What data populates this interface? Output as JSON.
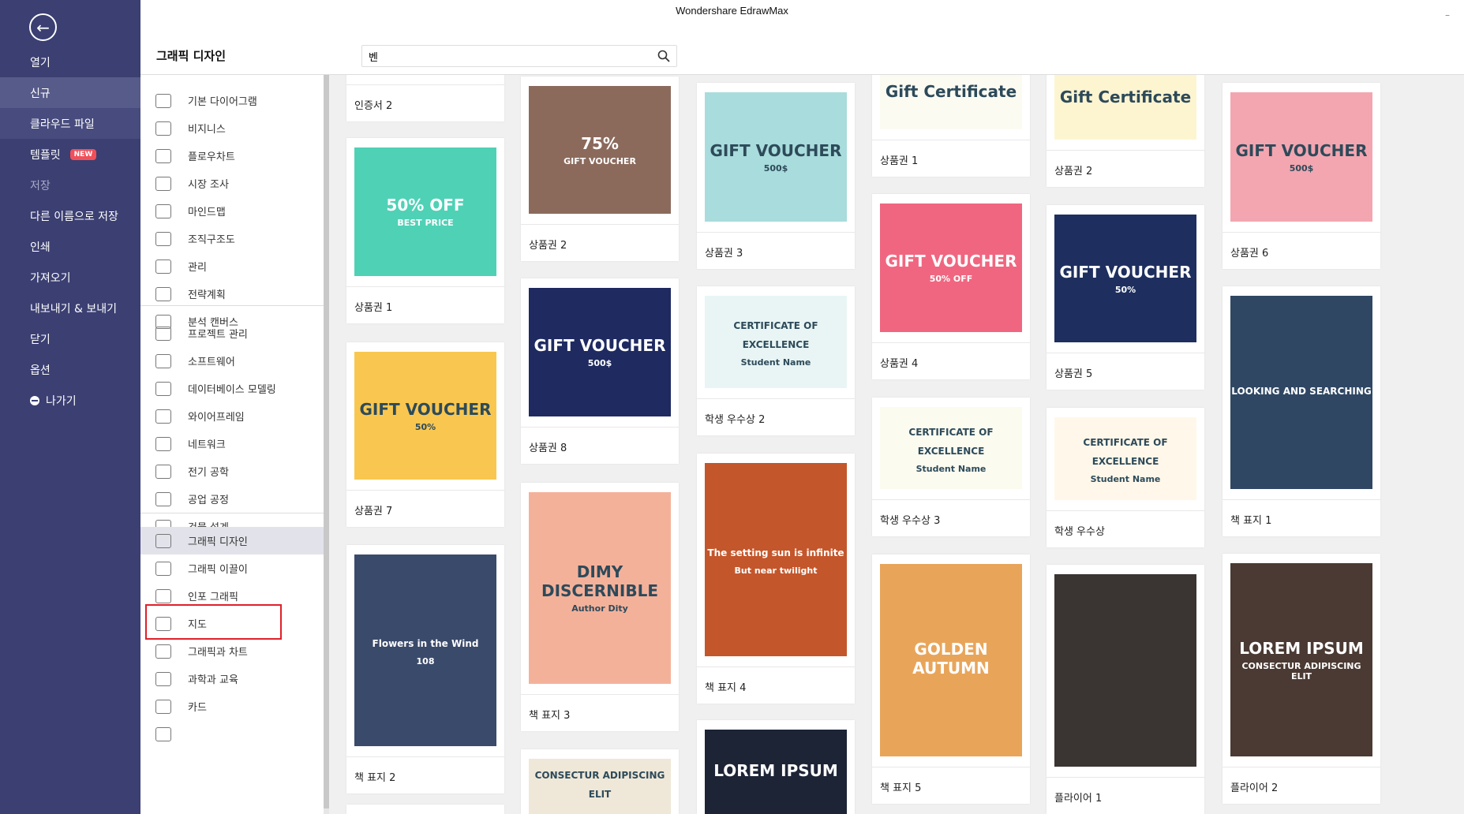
{
  "window": {
    "title": "Wondershare EdrawMax",
    "minimize": "–"
  },
  "sidebar": {
    "back": "←",
    "items": [
      {
        "label": "열기"
      },
      {
        "label": "신규",
        "state": "selected"
      },
      {
        "label": "클라우드 파일"
      },
      {
        "label": "템플릿",
        "badge": "NEW"
      },
      {
        "label": "저장",
        "state": "disabled"
      },
      {
        "label": "다른 이름으로 저장"
      },
      {
        "label": "인쇄"
      },
      {
        "label": "가져오기"
      },
      {
        "label": "내보내기 & 보내기"
      },
      {
        "label": "닫기"
      },
      {
        "label": "옵션"
      },
      {
        "label": "나가기",
        "icon": "minus-circle-icon"
      }
    ]
  },
  "page_title": "그래픽 디자인",
  "search": {
    "value": "벤",
    "icon": "search-icon"
  },
  "categories": {
    "group1": [
      "기본 다이어그램",
      "비지니스",
      "플로우차트",
      "시장 조사",
      "마인드맵",
      "조직구조도",
      "관리",
      "전략계획",
      "분석 캔버스"
    ],
    "group2": [
      "프로젝트 관리",
      "소프트웨어",
      "데이터베이스 모델링",
      "와이어프레임",
      "네트워크",
      "전기 공학",
      "공업 공정",
      "건물 설계"
    ],
    "group3": [
      "그래픽 디자인",
      "그래픽 이끌이",
      "인포 그래픽",
      "지도",
      "그래픽과 차트",
      "과학과 교육",
      "카드",
      ""
    ],
    "selected": "그래픽 디자인"
  },
  "templates": [
    [
      {
        "label": "인증서 2",
        "thumb": [
          "",
          ""
        ]
      },
      {
        "label": "상품권 1",
        "thumb": [
          "50% OFF",
          "BEST PRICE"
        ]
      },
      {
        "label": "상품권 7",
        "thumb": [
          "GIFT VOUCHER",
          "50%"
        ]
      },
      {
        "label": "책 표지 2",
        "thumb": [
          "Flowers in the Wind",
          "108"
        ]
      },
      {
        "label": "",
        "thumb": [
          "",
          ""
        ]
      }
    ],
    [
      {
        "label": "상품권 2",
        "thumb": [
          "75%",
          "GIFT VOUCHER"
        ]
      },
      {
        "label": "상품권 8",
        "thumb": [
          "GIFT VOUCHER",
          "500$"
        ]
      },
      {
        "label": "책 표지 3",
        "thumb": [
          "DIMY DISCERNIBLE",
          "Author Dity"
        ]
      },
      {
        "label": "",
        "thumb": [
          "CONSECTUR ADIPISCING ELIT",
          ""
        ]
      }
    ],
    [
      {
        "label": "상품권 3",
        "thumb": [
          "GIFT VOUCHER",
          "500$"
        ]
      },
      {
        "label": "학생 우수상 2",
        "thumb": [
          "CERTIFICATE OF EXCELLENCE",
          "Student Name"
        ]
      },
      {
        "label": "책 표지 4",
        "thumb": [
          "The setting sun is infinite",
          "But near twilight"
        ]
      },
      {
        "label": "",
        "thumb": [
          "LOREM IPSUM",
          ""
        ]
      }
    ],
    [
      {
        "label": "상품권 1",
        "thumb": [
          "Gift Certificate",
          ""
        ]
      },
      {
        "label": "상품권 4",
        "thumb": [
          "GIFT VOUCHER",
          "50% OFF"
        ]
      },
      {
        "label": "학생 우수상 3",
        "thumb": [
          "CERTIFICATE OF EXCELLENCE",
          "Student Name"
        ]
      },
      {
        "label": "책 표지 5",
        "thumb": [
          "GOLDEN AUTUMN",
          ""
        ]
      }
    ],
    [
      {
        "label": "상품권 2",
        "thumb": [
          "Gift Certificate",
          ""
        ]
      },
      {
        "label": "상품권 5",
        "thumb": [
          "GIFT VOUCHER",
          "50%"
        ]
      },
      {
        "label": "학생 우수상",
        "thumb": [
          "CERTIFICATE OF EXCELLENCE",
          "Student Name"
        ]
      },
      {
        "label": "플라이어 1",
        "thumb": [
          "",
          ""
        ]
      }
    ],
    [
      {
        "label": "상품권 6",
        "thumb": [
          "GIFT VOUCHER",
          "500$"
        ]
      },
      {
        "label": "책 표지 1",
        "thumb": [
          "LOOKING AND SEARCHING",
          ""
        ]
      },
      {
        "label": "플라이어 2",
        "thumb": [
          "LOREM IPSUM",
          "CONSECTUR ADIPISCING ELIT"
        ]
      }
    ]
  ],
  "colors": {
    "sidebar": "#3b3f72",
    "sidebar_selected": "#575b8a",
    "highlight_box": "#e0202a",
    "badge": "#f0505a"
  }
}
